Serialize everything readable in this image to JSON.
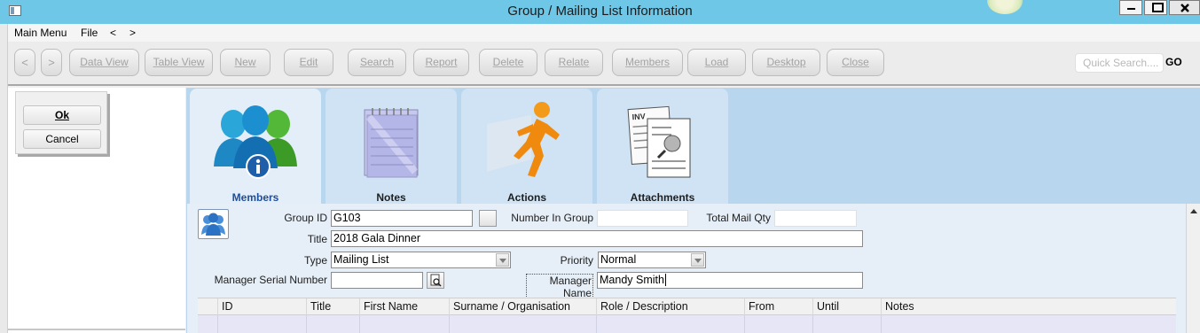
{
  "window": {
    "title": "Group / Mailing List Information"
  },
  "menu": {
    "items": [
      "Main Menu",
      "File",
      "<",
      ">"
    ]
  },
  "toolbar": {
    "buttons": [
      "<",
      ">",
      "Data View",
      "Table View",
      "New",
      "Edit",
      "Search",
      "Report",
      "Delete",
      "Relate",
      "Members",
      "Load",
      "Desktop",
      "Close"
    ],
    "quick_search_placeholder": "Quick Search....",
    "go_label": "GO"
  },
  "dialog": {
    "ok_label": "Ok",
    "cancel_label": "Cancel"
  },
  "tabs": [
    {
      "label": "Members",
      "icon": "members-icon",
      "active": true
    },
    {
      "label": "Notes",
      "icon": "notepad-icon",
      "active": false
    },
    {
      "label": "Actions",
      "icon": "running-man-icon",
      "active": false
    },
    {
      "label": "Attachments",
      "icon": "documents-icon",
      "active": false
    }
  ],
  "form": {
    "group_id_label": "Group ID",
    "group_id_value": "G103",
    "number_in_group_label": "Number In Group",
    "number_in_group_value": "",
    "total_mail_qty_label": "Total Mail Qty",
    "total_mail_qty_value": "",
    "title_label": "Title",
    "title_value": "2018 Gala Dinner",
    "type_label": "Type",
    "type_value": "Mailing List",
    "priority_label": "Priority",
    "priority_value": "Normal",
    "manager_serial_label": "Manager Serial Number",
    "manager_serial_value": "",
    "manager_name_label": "Manager Name",
    "manager_name_value": "Mandy Smith"
  },
  "grid": {
    "columns": [
      "ID",
      "Title",
      "First Name",
      "Surname / Organisation",
      "Role / Description",
      "From",
      "Until",
      "Notes"
    ]
  },
  "colors": {
    "titlebar": "#6fc7e7",
    "main_bg": "#b8d7ef",
    "active_tab_text": "#1d4e9c"
  }
}
